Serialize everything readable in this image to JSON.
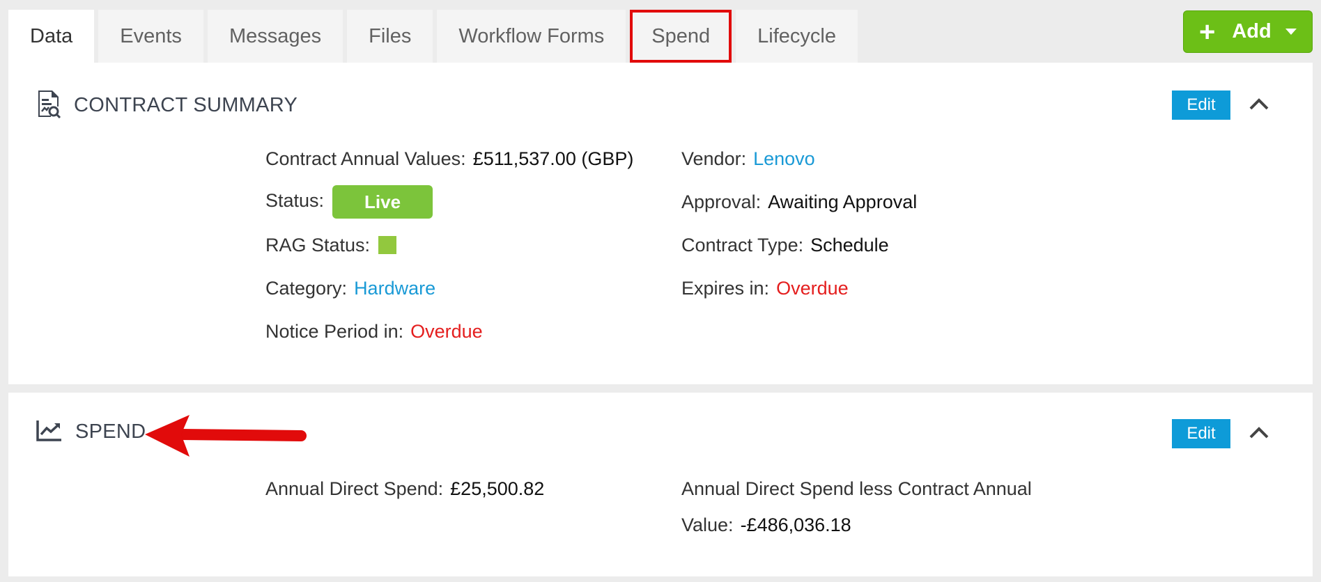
{
  "tabs": [
    {
      "label": "Data",
      "active": true
    },
    {
      "label": "Events"
    },
    {
      "label": "Messages"
    },
    {
      "label": "Files"
    },
    {
      "label": "Workflow Forms"
    },
    {
      "label": "Spend",
      "highlighted": true
    },
    {
      "label": "Lifecycle"
    }
  ],
  "add_button": {
    "label": "Add",
    "icon": "plus-icon"
  },
  "summary": {
    "title": "CONTRACT SUMMARY",
    "icon": "document-search-icon",
    "edit_label": "Edit",
    "fields": {
      "annual_value": {
        "label": "Contract Annual Values:",
        "value": "£511,537.00 (GBP)"
      },
      "status": {
        "label": "Status:",
        "value": "Live"
      },
      "rag": {
        "label": "RAG Status:",
        "color": "#92c83e"
      },
      "category": {
        "label": "Category:",
        "value": "Hardware"
      },
      "notice": {
        "label": "Notice Period in:",
        "value": "Overdue"
      },
      "vendor": {
        "label": "Vendor:",
        "value": "Lenovo"
      },
      "approval": {
        "label": "Approval:",
        "value": "Awaiting Approval"
      },
      "contract_type": {
        "label": "Contract Type:",
        "value": "Schedule"
      },
      "expires": {
        "label": "Expires in:",
        "value": "Overdue"
      }
    }
  },
  "spend": {
    "title": "SPEND",
    "icon": "trend-chart-icon",
    "edit_label": "Edit",
    "annual_direct": {
      "label": "Annual Direct Spend:",
      "value": "£25,500.82"
    },
    "less_contract": {
      "label_line1": "Annual Direct Spend less Contract Annual",
      "label_line2": "Value:",
      "value": "-£486,036.18"
    }
  },
  "colors": {
    "accent": "#0e9bd8",
    "add": "#6cbf17",
    "live": "#7cc43b",
    "overdue": "#e41e1e",
    "annotation": "#e10b0b"
  }
}
